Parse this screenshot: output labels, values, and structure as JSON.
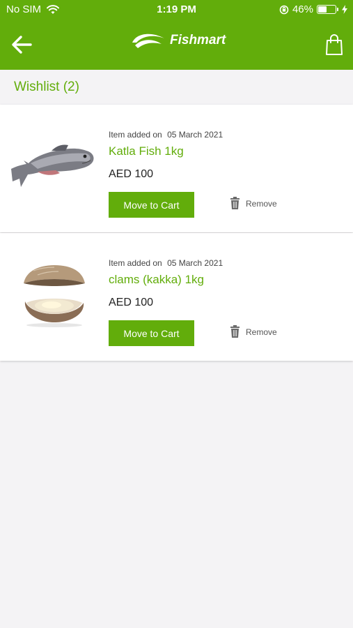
{
  "status_bar": {
    "carrier": "No SIM",
    "time": "1:19 PM",
    "battery_percent": "46%",
    "battery_level": 0.46,
    "icons": [
      "wifi-icon",
      "orientation-lock-icon",
      "battery-icon",
      "charging-bolt-icon"
    ]
  },
  "header": {
    "brand_name": "Fishmart",
    "back_icon": "back-arrow-icon",
    "cart_icon": "shopping-bag-icon",
    "bar_color": "#62ad0b"
  },
  "wishlist": {
    "title": "Wishlist (2)",
    "items": [
      {
        "added_label": "Item added on",
        "added_date": "05 March 2021",
        "name": "Katla Fish 1kg",
        "price": "AED 100",
        "move_label": "Move to Cart",
        "remove_label": "Remove",
        "image": "fish-image"
      },
      {
        "added_label": "Item added on",
        "added_date": "05 March 2021",
        "name": "clams (kakka) 1kg",
        "price": "AED 100",
        "move_label": "Move to Cart",
        "remove_label": "Remove",
        "image": "clam-image"
      }
    ]
  },
  "colors": {
    "accent": "#62ad0b",
    "background": "#f4f3f5",
    "card": "#ffffff"
  }
}
